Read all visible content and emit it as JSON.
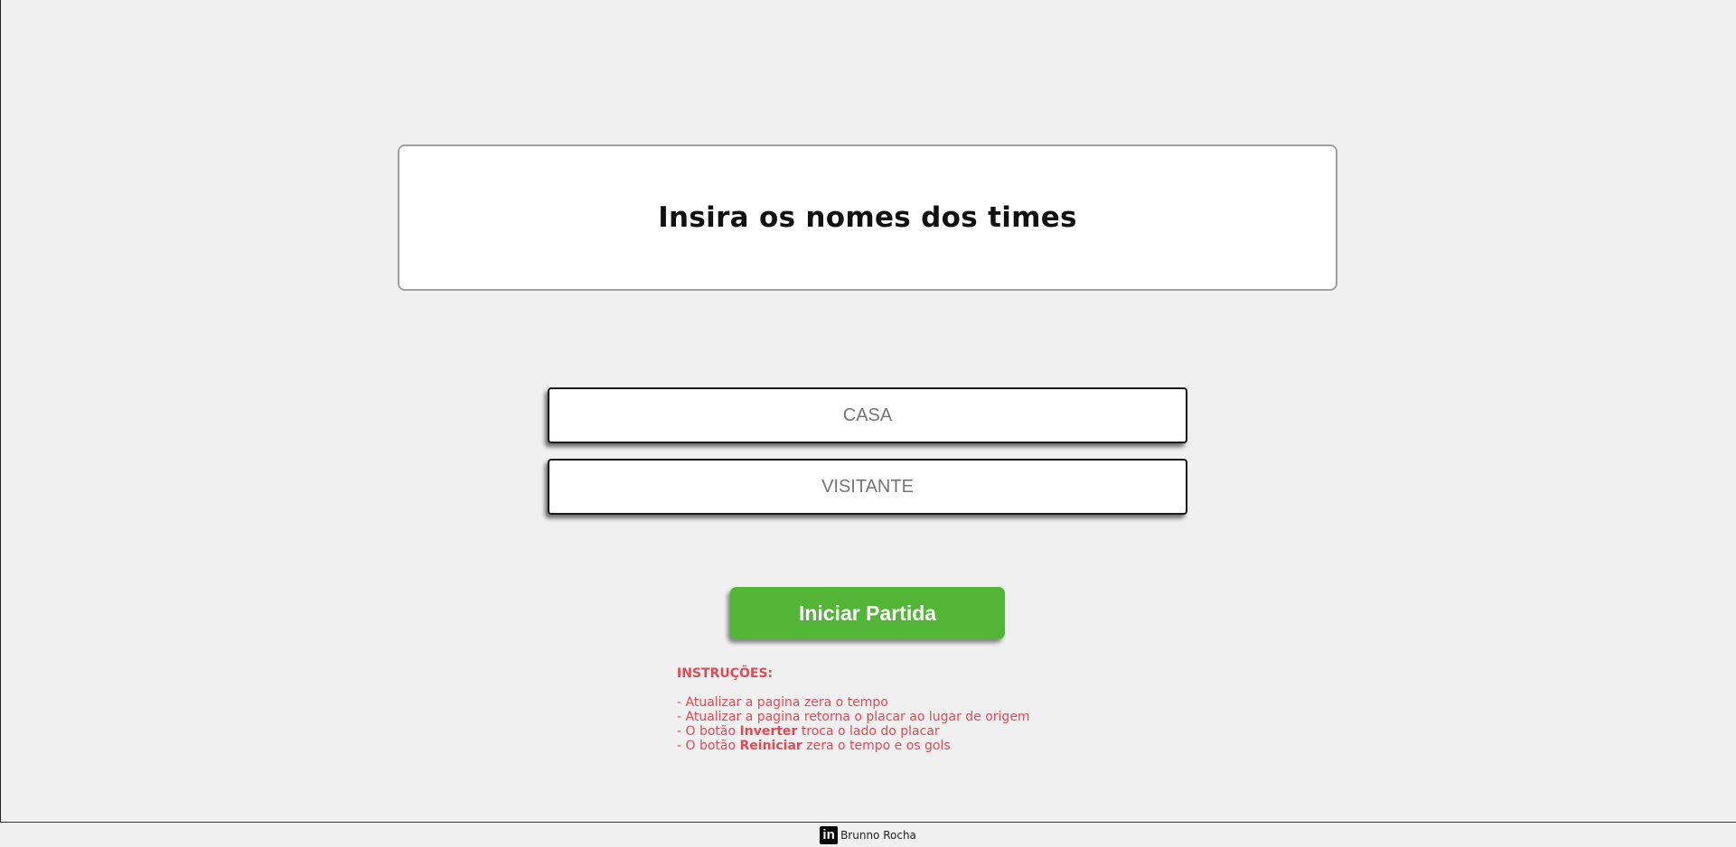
{
  "header": {
    "title": "Insira os nomes dos times"
  },
  "form": {
    "home_placeholder": "CASA",
    "home_value": "",
    "away_placeholder": "VISITANTE",
    "away_value": "",
    "start_button_label": "Iniciar Partida"
  },
  "instructions": {
    "heading": "INSTRUÇÕES:",
    "line1": "- Atualizar a pagina zera o tempo",
    "line2": "- Atualizar a pagina retorna o placar ao lugar de origem",
    "line3_prefix": "- O botão ",
    "line3_bold": "Inverter",
    "line3_suffix": " troca o lado do placar",
    "line4_prefix": "- O botão ",
    "line4_bold": "Reiniciar",
    "line4_suffix": " zera o tempo e os gols"
  },
  "footer": {
    "icon": "linkedin-icon",
    "icon_glyph": "in",
    "author": "Brunno Rocha"
  },
  "colors": {
    "background": "#f0f0f0",
    "button": "#53b536",
    "instructions_text": "#e04a55"
  }
}
